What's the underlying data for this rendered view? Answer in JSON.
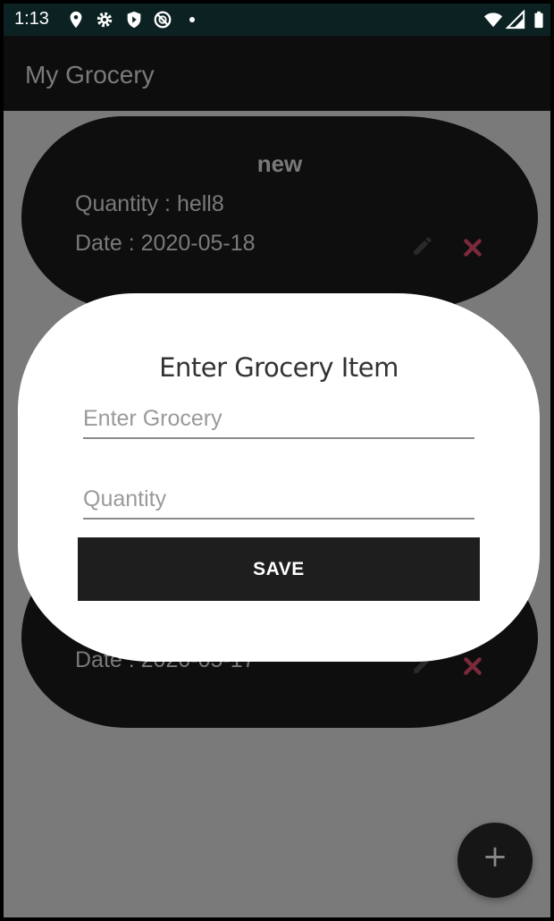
{
  "status_bar": {
    "time": "1:13",
    "left_icons": [
      "location-icon",
      "settings-gear-icon",
      "shield-play-icon",
      "do-not-disturb-icon",
      "notification-dot"
    ],
    "right_icons": [
      "wifi-icon",
      "cell-signal-icon",
      "battery-icon"
    ]
  },
  "app_bar": {
    "title": "My Grocery"
  },
  "items": [
    {
      "name": "new",
      "quantity_label": "Quantity   : hell8",
      "date_label": "Date  : 2020-05-18"
    },
    {
      "name": "",
      "quantity_label": "",
      "date_label": "Date  : 2020-05-17"
    }
  ],
  "dialog": {
    "title": "Enter Grocery Item",
    "grocery_placeholder": "Enter Grocery",
    "quantity_placeholder": "Quantity",
    "save_label": "SAVE"
  },
  "fab": {
    "label": "+"
  },
  "colors": {
    "delete_icon": "#7a2a3a",
    "dialog_bg": "#ffffff",
    "button_bg": "#1e1e1e",
    "overlay": "#7a7a7a"
  }
}
